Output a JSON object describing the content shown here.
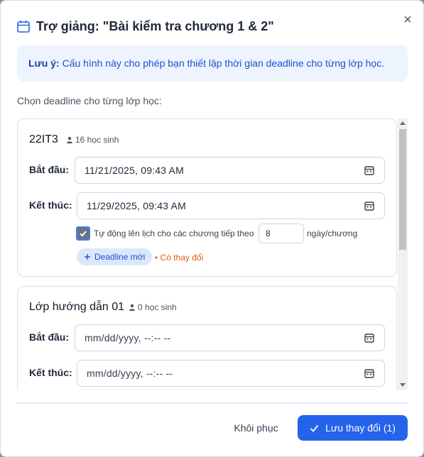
{
  "dialog": {
    "title": "Trợ giảng: \"Bài kiểm tra chương 1 & 2\"",
    "title_icon": "calendar-icon",
    "close_glyph": "×"
  },
  "note": {
    "label": "Lưu ý:",
    "text": "Cấu hình này cho phép bạn thiết lập thời gian deadline cho từng lớp học."
  },
  "subhead": "Chọn deadline cho từng lớp học:",
  "classes": [
    {
      "name": "22IT3",
      "students": "16 học sinh",
      "start_label": "Bắt đầu:",
      "start_value": "11/21/2025, 09:43 AM",
      "end_label": "Kết thúc:",
      "end_value": "11/29/2025, 09:43 AM",
      "auto_schedule": {
        "checked": true,
        "label": "Tự động lên lịch cho các chương tiếp theo",
        "value": "8",
        "unit": "ngày/chương"
      },
      "new_deadline_label": "Deadline mới",
      "changed_label": "• Có thay đổi"
    },
    {
      "name": "Lớp hướng dẫn 01",
      "students": "0 học sinh",
      "start_label": "Bắt đầu:",
      "start_value": "mm/dd/yyyy, --:-- --",
      "end_label": "Kết thúc:",
      "end_value": "mm/dd/yyyy, --:-- --"
    }
  ],
  "footer": {
    "reset_label": "Khôi phục",
    "save_label": "Lưu thay đổi (1)"
  },
  "colors": {
    "primary": "#2563eb",
    "note_bg": "#eef4fd",
    "changed": "#ea580c"
  }
}
